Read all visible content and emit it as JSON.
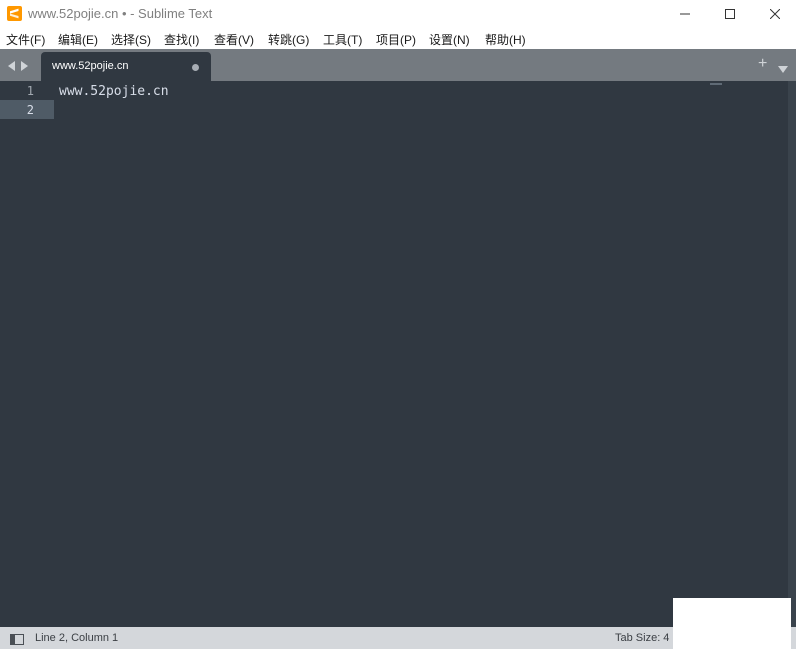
{
  "window": {
    "title": "www.52pojie.cn • - Sublime Text",
    "app_icon": "sublime-icon",
    "controls": [
      "minimize-icon",
      "maximize-icon",
      "close-icon"
    ]
  },
  "menu": {
    "items": [
      "文件(F)",
      "编辑(E)",
      "选择(S)",
      "查找(I)",
      "查看(V)",
      "转跳(G)",
      "工具(T)",
      "项目(P)",
      "设置(N)",
      "帮助(H)"
    ]
  },
  "tabs": {
    "active": {
      "label": "www.52pojie.cn",
      "modified": true
    },
    "new_tab_symbol": "+",
    "nav_icons": [
      "arrow-left-icon",
      "arrow-right-icon"
    ]
  },
  "editor": {
    "lines": [
      {
        "number": "1",
        "text": "www.52pojie.cn"
      },
      {
        "number": "2",
        "text": ""
      }
    ],
    "current_line": 2
  },
  "status": {
    "position": "Line 2, Column 1",
    "tab_size": "Tab Size: 4"
  },
  "colors": {
    "editor_bg": "#303841",
    "tabbar_bg": "#747a80",
    "accent": "#ff9800",
    "statusbar_bg": "#d4d7db"
  }
}
